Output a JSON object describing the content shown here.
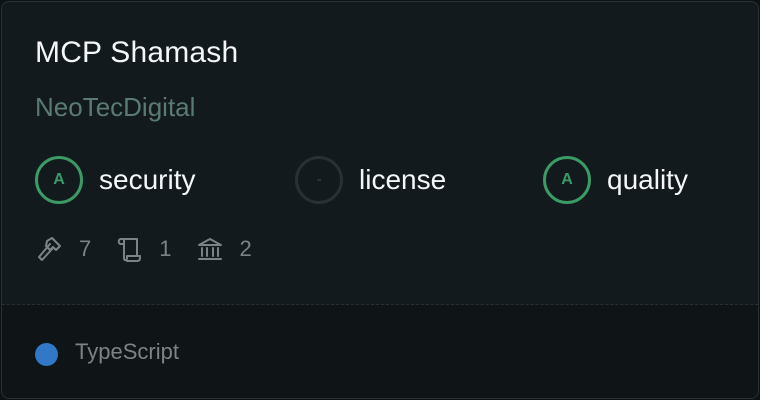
{
  "card": {
    "title": "MCP Shamash",
    "owner": "NeoTecDigital",
    "scores": [
      {
        "grade": "A",
        "label": "security",
        "status": "graded"
      },
      {
        "grade": "-",
        "label": "license",
        "status": "ungraded"
      },
      {
        "grade": "A",
        "label": "quality",
        "status": "graded"
      }
    ],
    "stats": {
      "tools": "7",
      "prompts": "1",
      "resources": "2"
    },
    "language": {
      "name": "TypeScript",
      "color": "#3178c6"
    }
  },
  "colors": {
    "background": "#0d1214",
    "card": "#121a1d",
    "footer": "#0f1517",
    "grade_a": "#3c9a67",
    "owner_text": "#5b7a72",
    "muted_text": "#7c8387"
  }
}
